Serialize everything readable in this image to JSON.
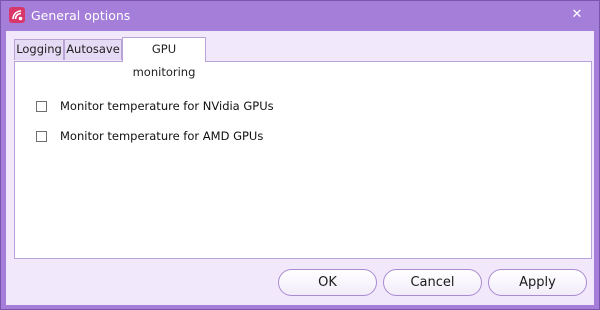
{
  "window": {
    "title": "General options",
    "close_icon": "close-icon",
    "app_icon": "app-logo-icon",
    "frame_color": "#a57ed9"
  },
  "tabs": [
    {
      "label": "Logging",
      "active": false
    },
    {
      "label": "Autosave",
      "active": false
    },
    {
      "label": "GPU monitoring",
      "active": true
    }
  ],
  "options": [
    {
      "label": "Monitor temperature for NVidia GPUs",
      "checked": false
    },
    {
      "label": "Monitor temperature for AMD GPUs",
      "checked": false
    }
  ],
  "buttons": {
    "ok": "OK",
    "cancel": "Cancel",
    "apply": "Apply"
  }
}
